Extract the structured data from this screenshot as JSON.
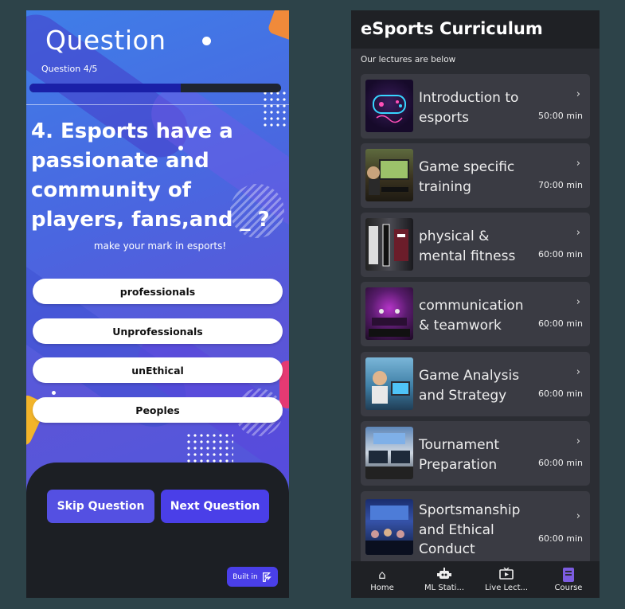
{
  "quiz": {
    "title": "Question",
    "counter": "Question 4/5",
    "progress_fraction": 0.6,
    "question": "4. Esports have a passionate and community of players, fans,and _ ?",
    "subtitle": "make your mark in esports!",
    "options": [
      "professionals",
      "Unprofessionals",
      "unEthical",
      "Peoples"
    ],
    "skip_label": "Skip Question",
    "next_label": "Next Question",
    "built_label": "Built in",
    "colors": {
      "accent": "#4a3fe8",
      "footer": "#1c1f24"
    }
  },
  "curriculum": {
    "title": "eSports Curriculum",
    "subtitle": "Our lectures are below",
    "lectures": [
      {
        "title": "Introduction to esports",
        "duration": "50:00 min",
        "thumb_icon": "gamepad-neon-icon"
      },
      {
        "title": "Game specific training",
        "duration": "70:00 min",
        "thumb_icon": "gaming-desk-icon"
      },
      {
        "title": "physical & mental fitness",
        "duration": "60:00 min",
        "thumb_icon": "training-gym-icon"
      },
      {
        "title": "communication & teamwork",
        "duration": "60:00 min",
        "thumb_icon": "stage-icon"
      },
      {
        "title": "Game Analysis and Strategy",
        "duration": "60:00 min",
        "thumb_icon": "player-headset-icon"
      },
      {
        "title": "Tournament Preparation",
        "duration": "60:00 min",
        "thumb_icon": "arena-icon"
      },
      {
        "title": "Sportsmanship and Ethical Conduct",
        "duration": "60:00 min",
        "thumb_icon": "crowd-icon"
      }
    ],
    "nav": [
      {
        "label": "Home",
        "icon": "home-icon"
      },
      {
        "label": "ML Stati...",
        "icon": "robot-icon"
      },
      {
        "label": "Live Lect...",
        "icon": "tv-icon"
      },
      {
        "label": "Course",
        "icon": "book-icon"
      }
    ],
    "colors": {
      "card": "#3a3b43",
      "bg": "#2b2d33",
      "active": "#7c5ce0"
    }
  }
}
